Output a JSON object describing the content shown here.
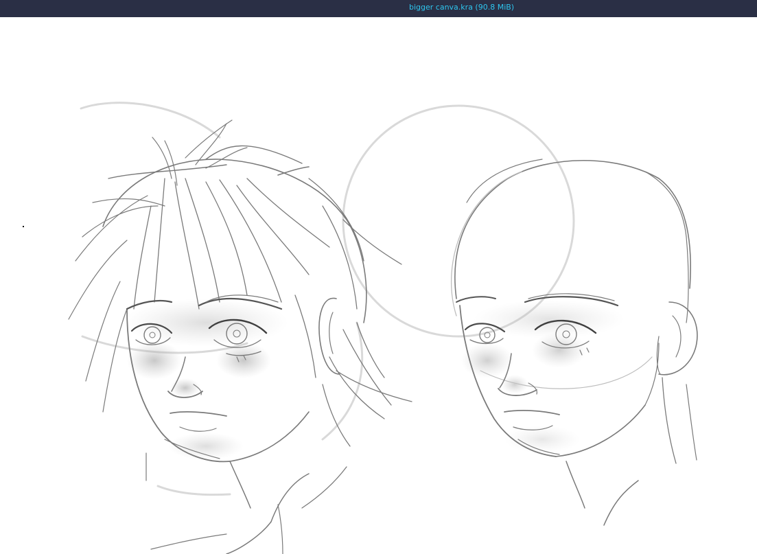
{
  "window": {
    "title": "bigger canva.kra (90.8 MiB)",
    "title_color": "#2ec6ef",
    "titlebar_color": "#2a2f45"
  },
  "canvas": {
    "background": "#ffffff",
    "content": "pencil-sketch-two-heads"
  }
}
